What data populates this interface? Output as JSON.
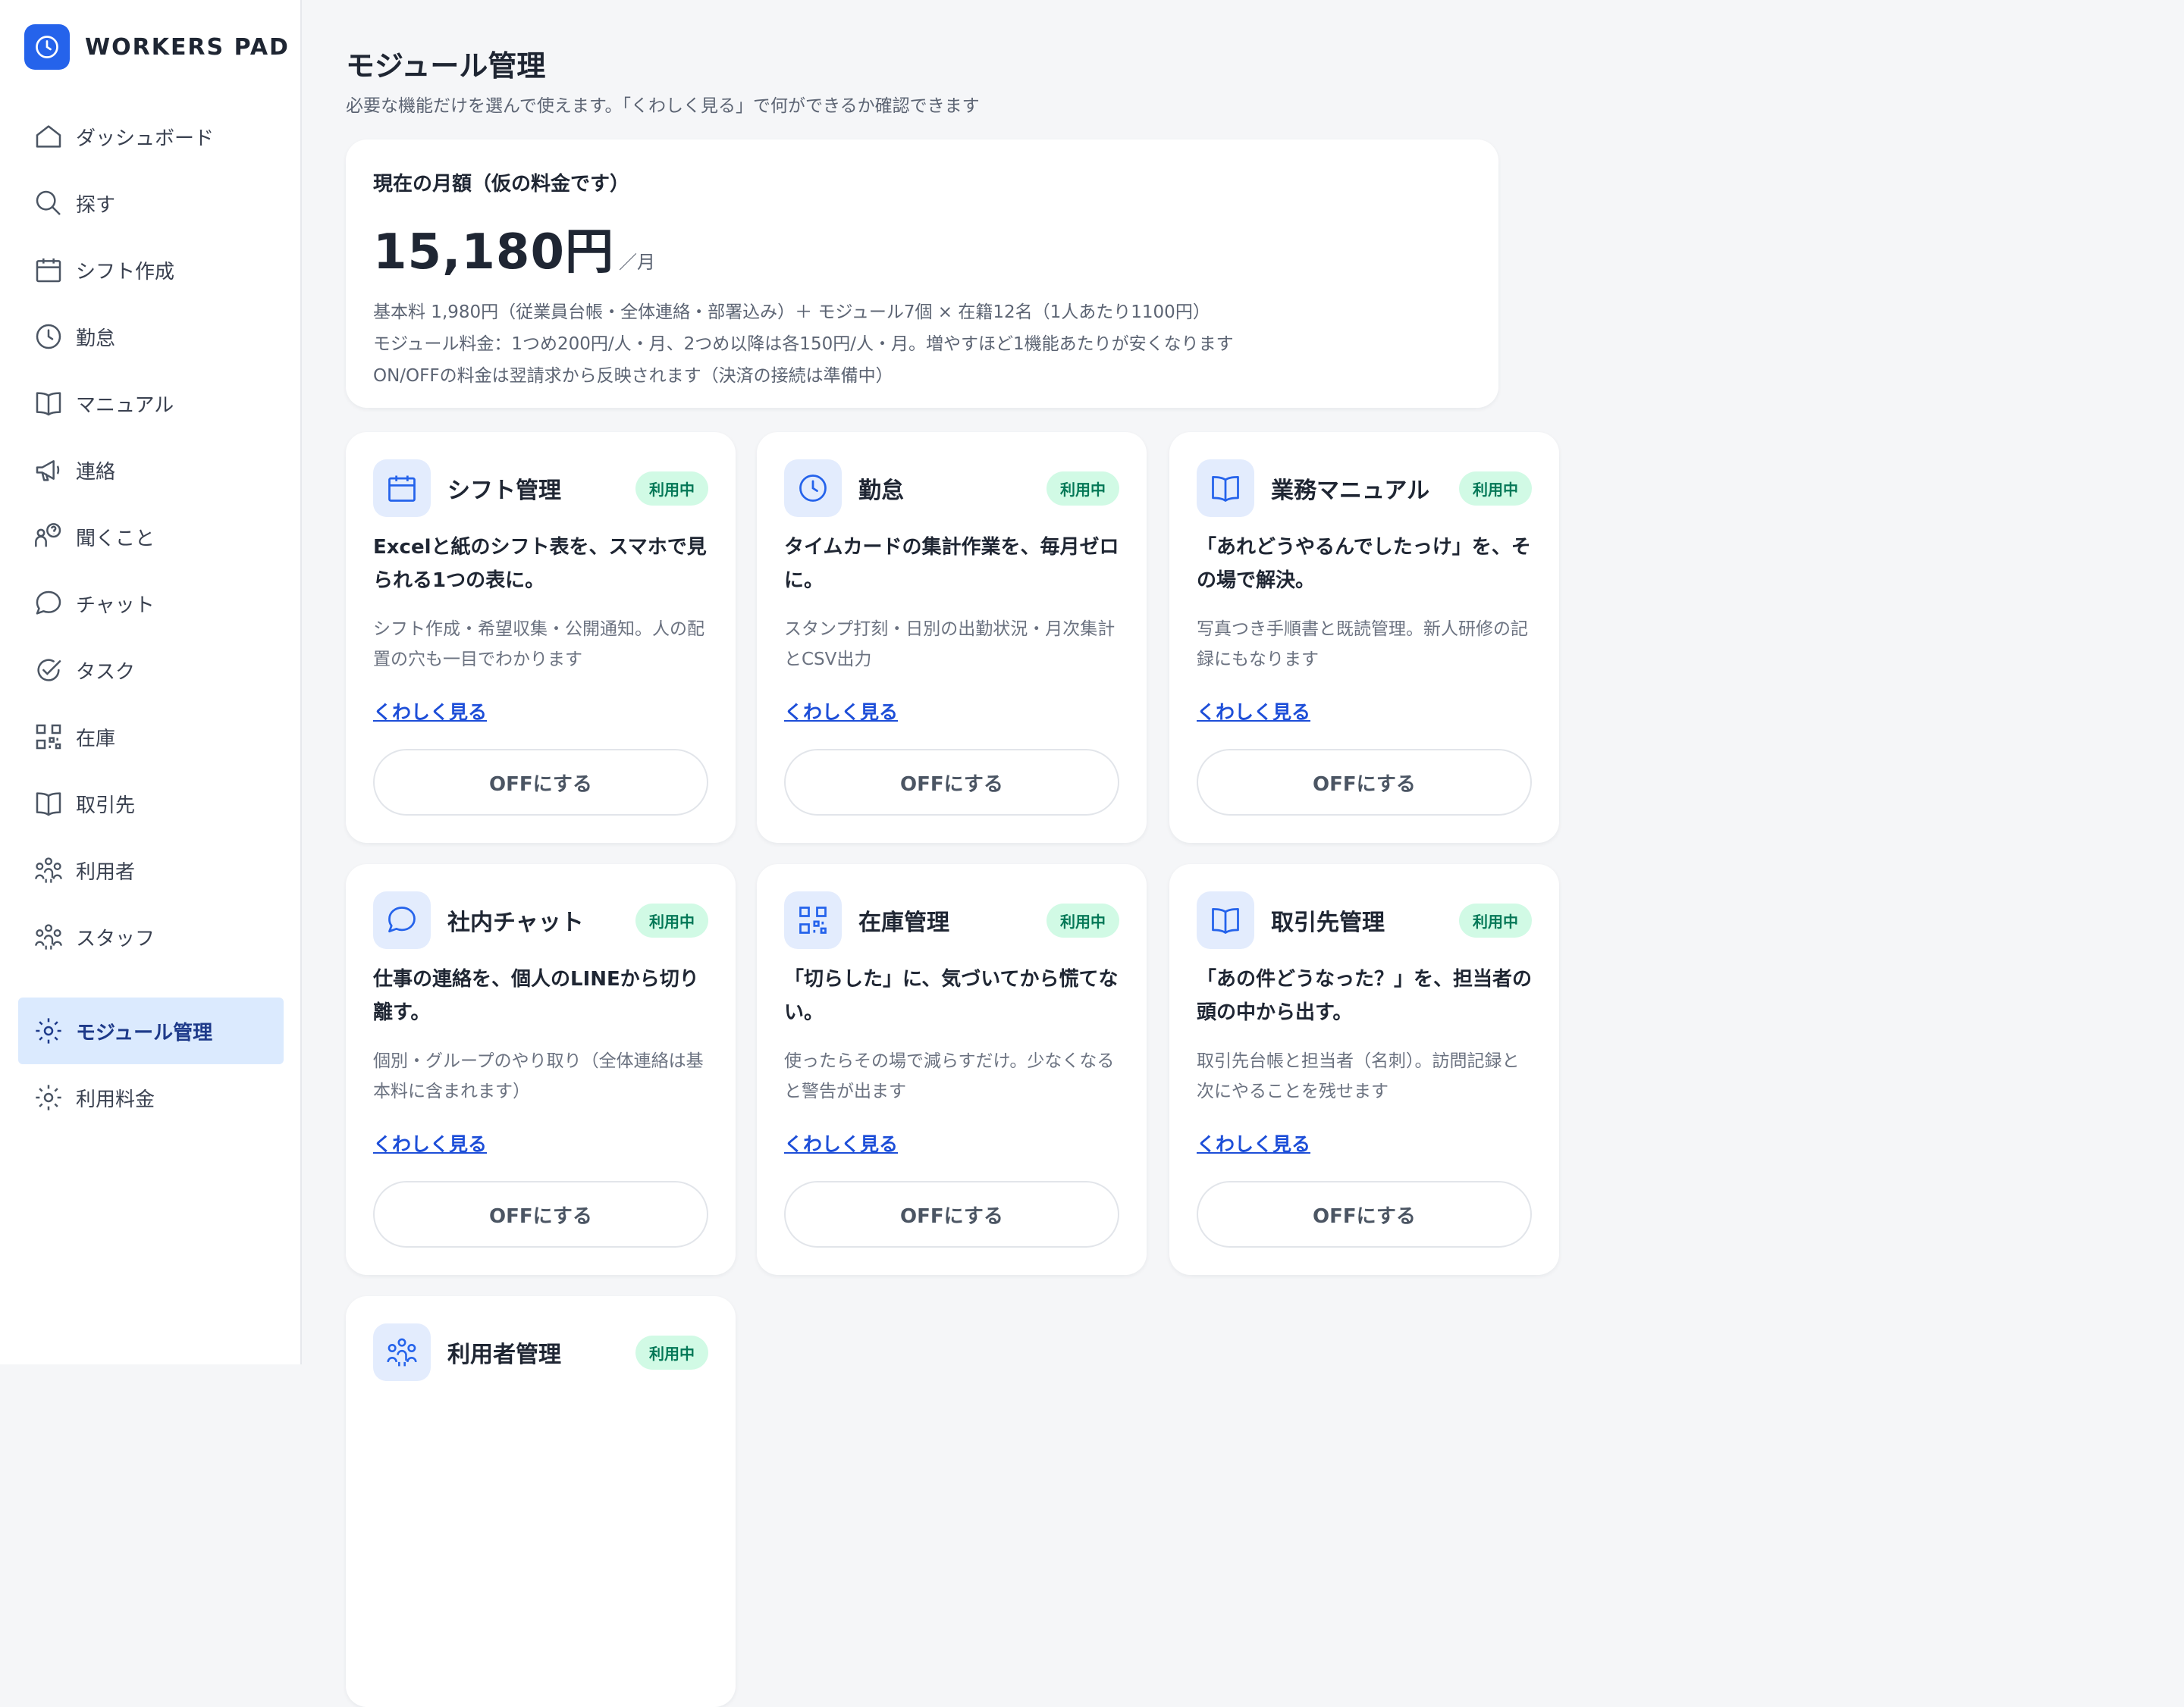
{
  "app": {
    "name": "WORKERS PAD"
  },
  "sidebar": {
    "items": [
      {
        "label": "ダッシュボード",
        "icon": "home-icon"
      },
      {
        "label": "探す",
        "icon": "search-icon"
      },
      {
        "label": "シフト作成",
        "icon": "calendar-icon"
      },
      {
        "label": "勤怠",
        "icon": "clock-icon"
      },
      {
        "label": "マニュアル",
        "icon": "book-icon"
      },
      {
        "label": "連絡",
        "icon": "megaphone-icon"
      },
      {
        "label": "聞くこと",
        "icon": "question-people-icon"
      },
      {
        "label": "チャット",
        "icon": "chat-bubble-icon"
      },
      {
        "label": "タスク",
        "icon": "check-icon"
      },
      {
        "label": "在庫",
        "icon": "qr-icon"
      },
      {
        "label": "取引先",
        "icon": "book-icon"
      },
      {
        "label": "利用者",
        "icon": "group-icon"
      },
      {
        "label": "スタッフ",
        "icon": "group-icon"
      },
      {
        "label": "モジュール管理",
        "icon": "gear-icon",
        "active": true
      },
      {
        "label": "利用料金",
        "icon": "gear-icon"
      }
    ]
  },
  "main": {
    "title": "モジュール管理",
    "subtitle": "必要な機能だけを選んで使えます。「くわしく見る」で何ができるか確認できます"
  },
  "pricing": {
    "heading": "現在の月額（仮の料金です）",
    "amount": "15,180円",
    "unit": "／月",
    "lines": [
      "基本料 1,980円（従業員台帳・全体連絡・部署込み）＋ モジュール7個 × 在籍12名（1人あたり1100円）",
      "モジュール料金：1つめ200円/人・月、2つめ以降は各150円/人・月。増やすほど1機能あたりが安くなります",
      "ON/OFFの料金は翌請求から反映されます（決済の接続は準備中）"
    ]
  },
  "modules": [
    {
      "name": "シフト管理",
      "icon": "calendar-icon",
      "badge": "利用中",
      "tagline": "Excelと紙のシフト表を、スマホで見られる1つの表に。",
      "desc": "シフト作成・希望収集・公開通知。人の配置の穴も一目でわかります",
      "link": "くわしく見る",
      "button": "OFFにする"
    },
    {
      "name": "勤怠",
      "icon": "clock-icon",
      "badge": "利用中",
      "tagline": "タイムカードの集計作業を、毎月ゼロに。",
      "desc": "スタンプ打刻・日別の出勤状況・月次集計とCSV出力",
      "link": "くわしく見る",
      "button": "OFFにする"
    },
    {
      "name": "業務マニュアル",
      "icon": "book-icon",
      "badge": "利用中",
      "tagline": "「あれどうやるんでしたっけ」を、その場で解決。",
      "desc": "写真つき手順書と既読管理。新人研修の記録にもなります",
      "link": "くわしく見る",
      "button": "OFFにする"
    },
    {
      "name": "社内チャット",
      "icon": "chat-bubble-icon",
      "badge": "利用中",
      "tagline": "仕事の連絡を、個人のLINEから切り離す。",
      "desc": "個別・グループのやり取り（全体連絡は基本料に含まれます）",
      "link": "くわしく見る",
      "button": "OFFにする"
    },
    {
      "name": "在庫管理",
      "icon": "qr-icon",
      "badge": "利用中",
      "tagline": "「切らした」に、気づいてから慌てない。",
      "desc": "使ったらその場で減らすだけ。少なくなると警告が出ます",
      "link": "くわしく見る",
      "button": "OFFにする"
    },
    {
      "name": "取引先管理",
      "icon": "book-icon",
      "badge": "利用中",
      "tagline": "「あの件どうなった？」を、担当者の頭の中から出す。",
      "desc": "取引先台帳と担当者（名刺）。訪問記録と次にやることを残せます",
      "link": "くわしく見る",
      "button": "OFFにする"
    },
    {
      "name": "利用者管理",
      "icon": "group-icon",
      "badge": "利用中",
      "tagline": "",
      "desc": "",
      "link": "",
      "button": ""
    }
  ],
  "colors": {
    "accent": "#2563eb",
    "active_nav_bg": "#dbeafe",
    "badge_bg": "#d1fae5",
    "badge_text": "#047857",
    "link": "#1d4ed8"
  }
}
